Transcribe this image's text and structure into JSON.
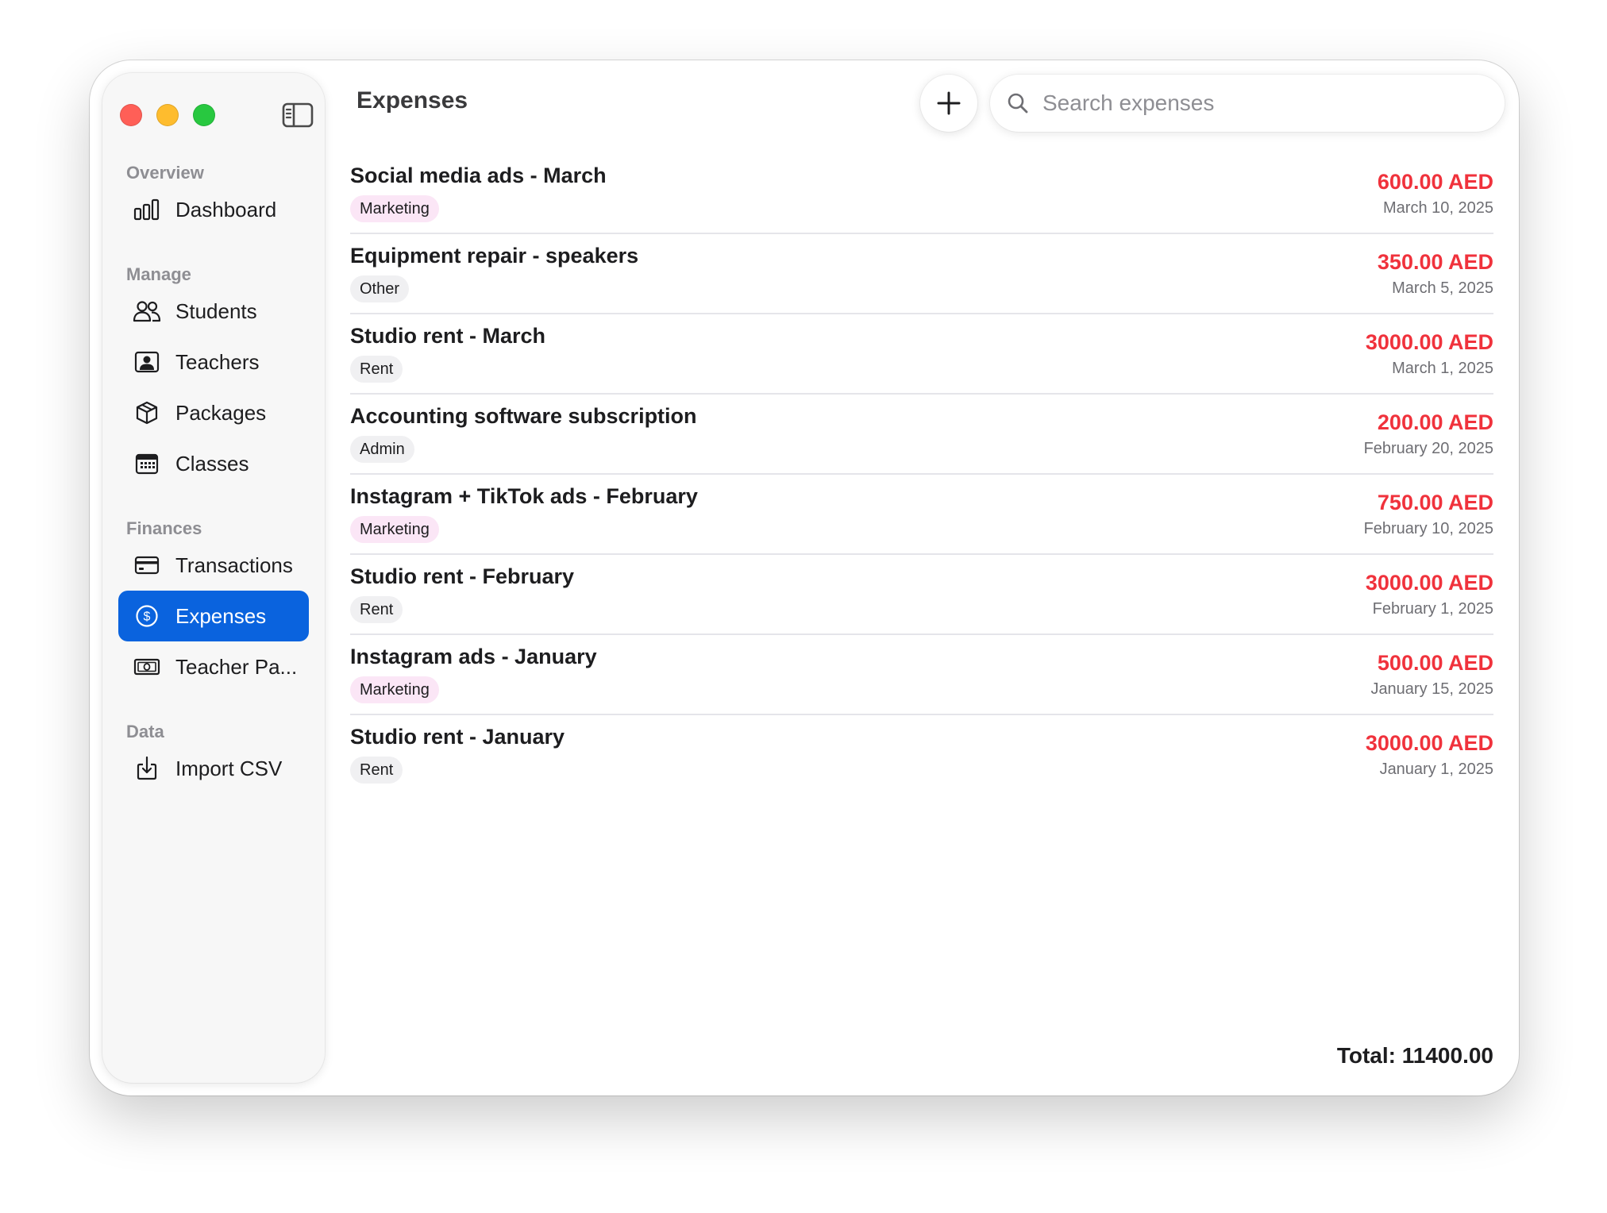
{
  "window": {
    "title": "Expenses"
  },
  "sidebar": {
    "sections": [
      {
        "label": "Overview",
        "items": [
          {
            "label": "Dashboard",
            "icon": "chart-bar-icon"
          }
        ]
      },
      {
        "label": "Manage",
        "items": [
          {
            "label": "Students",
            "icon": "people-icon"
          },
          {
            "label": "Teachers",
            "icon": "person-card-icon"
          },
          {
            "label": "Packages",
            "icon": "box-icon"
          },
          {
            "label": "Classes",
            "icon": "calendar-icon"
          }
        ]
      },
      {
        "label": "Finances",
        "items": [
          {
            "label": "Transactions",
            "icon": "credit-card-icon"
          },
          {
            "label": "Expenses",
            "icon": "dollar-circle-icon",
            "selected": true
          },
          {
            "label": "Teacher Pa...",
            "icon": "banknote-icon"
          }
        ]
      },
      {
        "label": "Data",
        "items": [
          {
            "label": "Import CSV",
            "icon": "import-icon"
          }
        ]
      }
    ]
  },
  "search": {
    "placeholder": "Search expenses",
    "value": ""
  },
  "expenses": [
    {
      "name": "Social media ads - March",
      "category": "Marketing",
      "amount": "600.00 AED",
      "date": "March 10, 2025"
    },
    {
      "name": "Equipment repair - speakers",
      "category": "Other",
      "amount": "350.00 AED",
      "date": "March 5, 2025"
    },
    {
      "name": "Studio rent - March",
      "category": "Rent",
      "amount": "3000.00 AED",
      "date": "March 1, 2025"
    },
    {
      "name": "Accounting software subscription",
      "category": "Admin",
      "amount": "200.00 AED",
      "date": "February 20, 2025"
    },
    {
      "name": "Instagram + TikTok ads - February",
      "category": "Marketing",
      "amount": "750.00 AED",
      "date": "February 10, 2025"
    },
    {
      "name": "Studio rent - February",
      "category": "Rent",
      "amount": "3000.00 AED",
      "date": "February 1, 2025"
    },
    {
      "name": "Instagram ads - January",
      "category": "Marketing",
      "amount": "500.00 AED",
      "date": "January 15, 2025"
    },
    {
      "name": "Studio rent - January",
      "category": "Rent",
      "amount": "3000.00 AED",
      "date": "January 1, 2025"
    }
  ],
  "total_label": "Total: 11400.00",
  "colors": {
    "accent": "#0a63de",
    "amount": "#f0323c",
    "marketing_tag_bg": "#fbe6f6",
    "default_tag_bg": "#f0f0f2"
  }
}
